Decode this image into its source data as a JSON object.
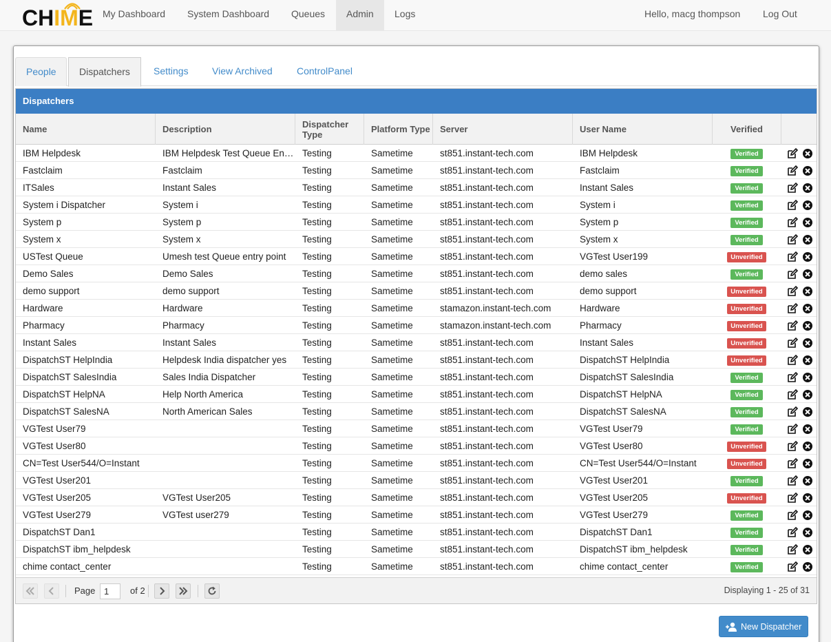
{
  "logo": {
    "part1": "CH",
    "part2": "IM",
    "part3": "E"
  },
  "nav": {
    "items": [
      {
        "label": "My Dashboard"
      },
      {
        "label": "System Dashboard"
      },
      {
        "label": "Queues"
      },
      {
        "label": "Admin",
        "active": true
      },
      {
        "label": "Logs"
      }
    ],
    "greeting": "Hello, macg thompson",
    "logout": "Log Out"
  },
  "tabs": [
    {
      "label": "People"
    },
    {
      "label": "Dispatchers",
      "active": true
    },
    {
      "label": "Settings"
    },
    {
      "label": "View Archived"
    },
    {
      "label": "ControlPanel"
    }
  ],
  "grid": {
    "title": "Dispatchers",
    "columns": [
      "Name",
      "Description",
      "Dispatcher Type",
      "Platform Type",
      "Server",
      "User Name",
      "Verified",
      ""
    ],
    "rows": [
      {
        "name": "IBM Helpdesk",
        "desc": "IBM Helpdesk Test Queue Entry Point",
        "type": "Testing",
        "platform": "Sametime",
        "server": "st851.instant-tech.com",
        "user": "IBM Helpdesk",
        "verified": "Verified"
      },
      {
        "name": "Fastclaim",
        "desc": "Fastclaim",
        "type": "Testing",
        "platform": "Sametime",
        "server": "st851.instant-tech.com",
        "user": "Fastclaim",
        "verified": "Verified"
      },
      {
        "name": "ITSales",
        "desc": "Instant Sales",
        "type": "Testing",
        "platform": "Sametime",
        "server": "st851.instant-tech.com",
        "user": "Instant Sales",
        "verified": "Verified"
      },
      {
        "name": "System i Dispatcher",
        "desc": "System i",
        "type": "Testing",
        "platform": "Sametime",
        "server": "st851.instant-tech.com",
        "user": "System i",
        "verified": "Verified"
      },
      {
        "name": "System p",
        "desc": "System p",
        "type": "Testing",
        "platform": "Sametime",
        "server": "st851.instant-tech.com",
        "user": "System p",
        "verified": "Verified"
      },
      {
        "name": "System x",
        "desc": "System x",
        "type": "Testing",
        "platform": "Sametime",
        "server": "st851.instant-tech.com",
        "user": "System x",
        "verified": "Verified"
      },
      {
        "name": "USTest Queue",
        "desc": "Umesh test Queue entry point",
        "type": "Testing",
        "platform": "Sametime",
        "server": "st851.instant-tech.com",
        "user": "VGTest User199",
        "verified": "Unverified"
      },
      {
        "name": "Demo Sales",
        "desc": "Demo Sales",
        "type": "Testing",
        "platform": "Sametime",
        "server": "st851.instant-tech.com",
        "user": "demo sales",
        "verified": "Verified"
      },
      {
        "name": "demo support",
        "desc": "demo support",
        "type": "Testing",
        "platform": "Sametime",
        "server": "st851.instant-tech.com",
        "user": "demo support",
        "verified": "Unverified"
      },
      {
        "name": "Hardware",
        "desc": "Hardware",
        "type": "Testing",
        "platform": "Sametime",
        "server": "stamazon.instant-tech.com",
        "user": "Hardware",
        "verified": "Unverified"
      },
      {
        "name": "Pharmacy",
        "desc": "Pharmacy",
        "type": "Testing",
        "platform": "Sametime",
        "server": "stamazon.instant-tech.com",
        "user": "Pharmacy",
        "verified": "Unverified"
      },
      {
        "name": "Instant Sales",
        "desc": "Instant Sales",
        "type": "Testing",
        "platform": "Sametime",
        "server": "st851.instant-tech.com",
        "user": "Instant Sales",
        "verified": "Unverified"
      },
      {
        "name": "DispatchST HelpIndia",
        "desc": "Helpdesk India dispatcher yes",
        "type": "Testing",
        "platform": "Sametime",
        "server": "st851.instant-tech.com",
        "user": "DispatchST HelpIndia",
        "verified": "Unverified"
      },
      {
        "name": "DispatchST SalesIndia",
        "desc": "Sales India Dispatcher",
        "type": "Testing",
        "platform": "Sametime",
        "server": "st851.instant-tech.com",
        "user": "DispatchST SalesIndia",
        "verified": "Verified"
      },
      {
        "name": "DispatchST HelpNA",
        "desc": "Help North America",
        "type": "Testing",
        "platform": "Sametime",
        "server": "st851.instant-tech.com",
        "user": "DispatchST HelpNA",
        "verified": "Verified"
      },
      {
        "name": "DispatchST SalesNA",
        "desc": "North American Sales",
        "type": "Testing",
        "platform": "Sametime",
        "server": "st851.instant-tech.com",
        "user": "DispatchST SalesNA",
        "verified": "Verified"
      },
      {
        "name": "VGTest User79",
        "desc": "",
        "type": "Testing",
        "platform": "Sametime",
        "server": "st851.instant-tech.com",
        "user": "VGTest User79",
        "verified": "Verified"
      },
      {
        "name": "VGTest User80",
        "desc": "",
        "type": "Testing",
        "platform": "Sametime",
        "server": "st851.instant-tech.com",
        "user": "VGTest User80",
        "verified": "Unverified"
      },
      {
        "name": "CN=Test User544/O=Instant",
        "desc": "",
        "type": "Testing",
        "platform": "Sametime",
        "server": "st851.instant-tech.com",
        "user": "CN=Test User544/O=Instant",
        "verified": "Unverified"
      },
      {
        "name": "VGTest User201",
        "desc": "",
        "type": "Testing",
        "platform": "Sametime",
        "server": "st851.instant-tech.com",
        "user": "VGTest User201",
        "verified": "Verified"
      },
      {
        "name": "VGTest User205",
        "desc": "VGTest User205",
        "type": "Testing",
        "platform": "Sametime",
        "server": "st851.instant-tech.com",
        "user": "VGTest User205",
        "verified": "Unverified"
      },
      {
        "name": "VGTest User279",
        "desc": "VGTest user279",
        "type": "Testing",
        "platform": "Sametime",
        "server": "st851.instant-tech.com",
        "user": "VGTest User279",
        "verified": "Verified"
      },
      {
        "name": "DispatchST Dan1",
        "desc": "",
        "type": "Testing",
        "platform": "Sametime",
        "server": "st851.instant-tech.com",
        "user": "DispatchST Dan1",
        "verified": "Verified"
      },
      {
        "name": "DispatchST ibm_helpdesk",
        "desc": "",
        "type": "Testing",
        "platform": "Sametime",
        "server": "st851.instant-tech.com",
        "user": "DispatchST ibm_helpdesk",
        "verified": "Verified"
      },
      {
        "name": "chime contact_center",
        "desc": "",
        "type": "Testing",
        "platform": "Sametime",
        "server": "st851.instant-tech.com",
        "user": "chime contact_center",
        "verified": "Verified"
      }
    ]
  },
  "pager": {
    "page_label": "Page",
    "page_value": "1",
    "of_label": "of 2",
    "displaying": "Displaying 1 - 25 of 31"
  },
  "new_button": {
    "label": "New Dispatcher"
  },
  "colors": {
    "header_blue": "#3b7ec4",
    "verified": "#5cb85c",
    "unverified": "#d9534f",
    "logo_accent": "#f3b51d"
  }
}
